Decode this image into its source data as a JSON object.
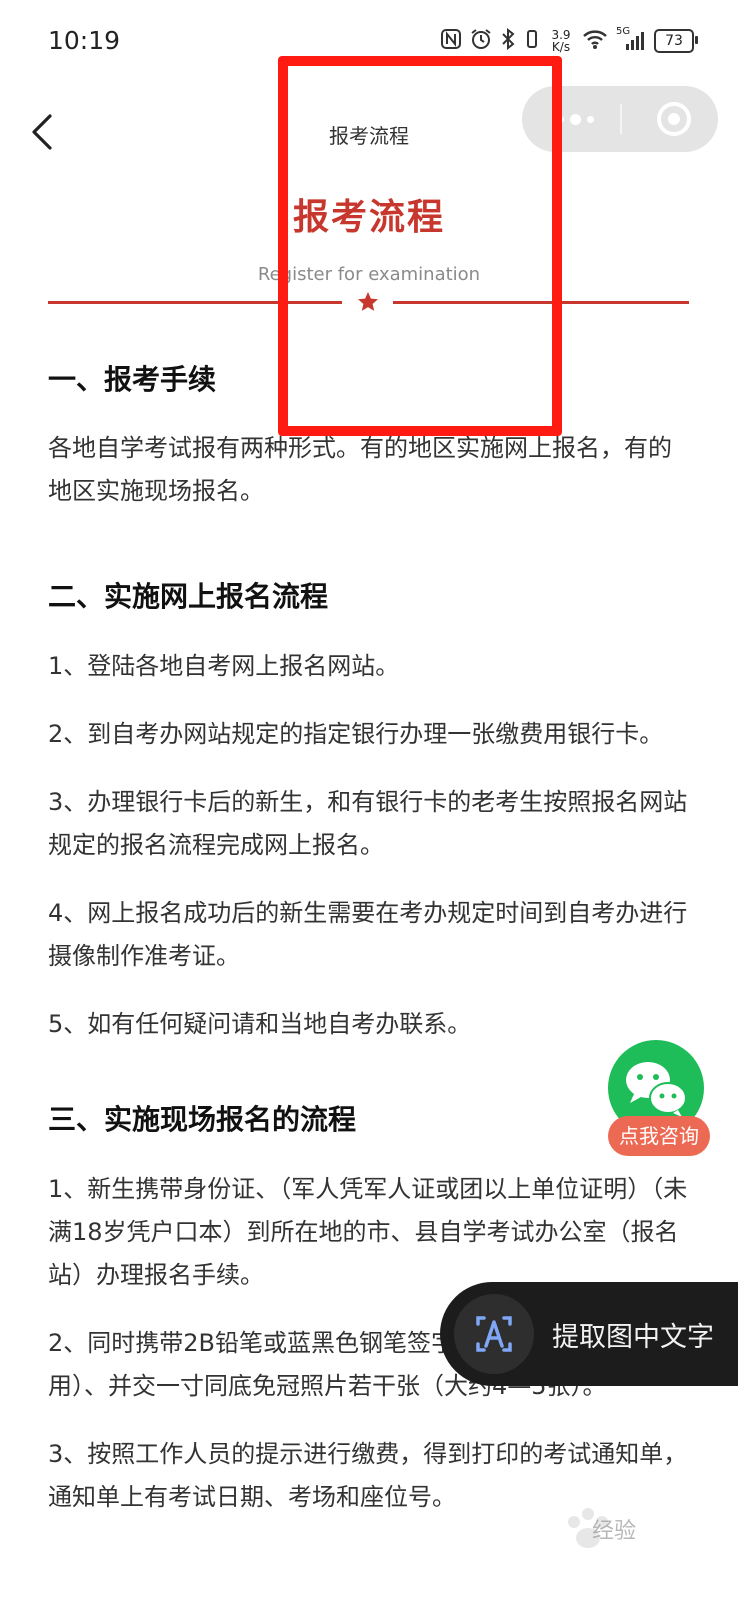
{
  "status_bar": {
    "time": "10:19",
    "net_speed_value": "3.9",
    "net_speed_unit": "K/s",
    "signal_label": "5G",
    "battery": "73"
  },
  "nav": {
    "title": "报考流程"
  },
  "banner": {
    "title": "报考流程",
    "subtitle": "Register for examination",
    "accent_color": "#c8372d"
  },
  "annotation": {
    "box_color": "#ff1a12"
  },
  "article": {
    "section1": {
      "heading": "一、报考手续",
      "paragraphs": [
        "各地自学考试报有两种形式。有的地区实施网上报名，有的地区实施现场报名。"
      ]
    },
    "section2": {
      "heading": "二、实施网上报名流程",
      "paragraphs": [
        "1、登陆各地自考网上报名网站。",
        "2、到自考办网站规定的指定银行办理一张缴费用银行卡。",
        "3、办理银行卡后的新生，和有银行卡的老考生按照报名网站规定的报名流程完成网上报名。",
        "4、网上报名成功后的新生需要在考办规定时间到自考办进行摄像制作准考证。",
        "5、如有任何疑问请和当地自考办联系。"
      ]
    },
    "section3": {
      "heading": "三、实施现场报名的流程",
      "paragraphs": [
        "1、新生携带身份证、（军人凭军人证或团以上单位证明）（未满18岁凭户口本）到所在地的市、县自学考试办公室（报名站）办理报名手续。",
        "2、同时携带2B铅笔或蓝黑色钢笔签字笔（填涂机读报名卡用）、并交一寸同底免冠照片若干张（大约4—5张）。",
        "3、按照工作人员的提示进行缴费，得到打印的考试通知单，通知单上有考试日期、考场和座位号。"
      ]
    }
  },
  "floating": {
    "consult_label": "点我咨询",
    "wechat_color": "#1fbd5a",
    "extract_label": "提取图中文字"
  },
  "watermark": {
    "text": "经验"
  }
}
